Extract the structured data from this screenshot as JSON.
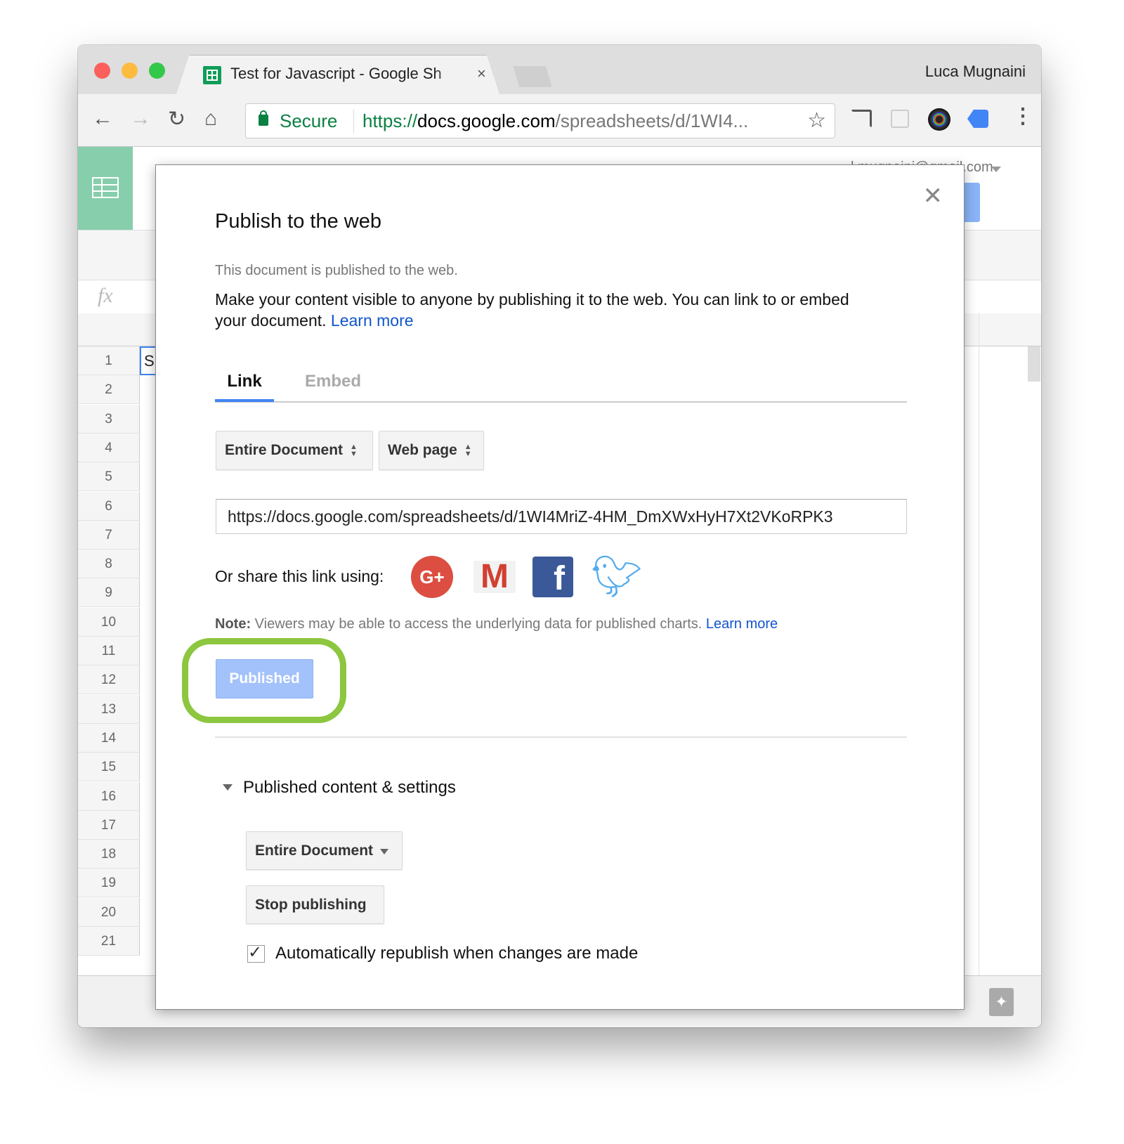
{
  "browser": {
    "tab_title": "Test for Javascript - Google Sh",
    "profile_name": "Luca Mugnaini",
    "secure_label": "Secure",
    "url_scheme": "https://",
    "url_host": "docs.google.com",
    "url_path": "/spreadsheets/d/1WI4...",
    "traffic_colors": [
      "#fc605c",
      "#fdbc40",
      "#34c84a"
    ]
  },
  "sheet": {
    "account_email": "l.mugnaini@gmail.com",
    "formula_icon": "fx",
    "cell_a1": "S",
    "row_numbers": [
      "1",
      "2",
      "3",
      "4",
      "5",
      "6",
      "7",
      "8",
      "9",
      "10",
      "11",
      "12",
      "13",
      "14",
      "15",
      "16",
      "17",
      "18",
      "19",
      "20",
      "21"
    ],
    "brand_color": "#87ceac"
  },
  "dialog": {
    "title": "Publish to the web",
    "status": "This document is published to the web.",
    "description": "Make your content visible to anyone by publishing it to the web. You can link to or embed your document.",
    "learn_more": "Learn more",
    "tabs": [
      {
        "label": "Link",
        "active": true
      },
      {
        "label": "Embed",
        "active": false
      }
    ],
    "scope_select": "Entire Document",
    "format_select": "Web page",
    "link_value": "https://docs.google.com/spreadsheets/d/1WI4MriZ-4HM_DmXWxHyH7Xt2VKoRPK3",
    "share_label": "Or share this link using:",
    "share_icons": [
      "google-plus",
      "gmail",
      "facebook",
      "twitter"
    ],
    "note_label": "Note:",
    "note_text": "Viewers may be able to access the underlying data for published charts.",
    "note_learn_more": "Learn more",
    "published_button": "Published",
    "highlight_color": "#8dc63f",
    "settings_header": "Published content & settings",
    "settings_scope": "Entire Document",
    "stop_publishing": "Stop publishing",
    "auto_republish_label": "Automatically republish when changes are made",
    "auto_republish_checked": true
  }
}
